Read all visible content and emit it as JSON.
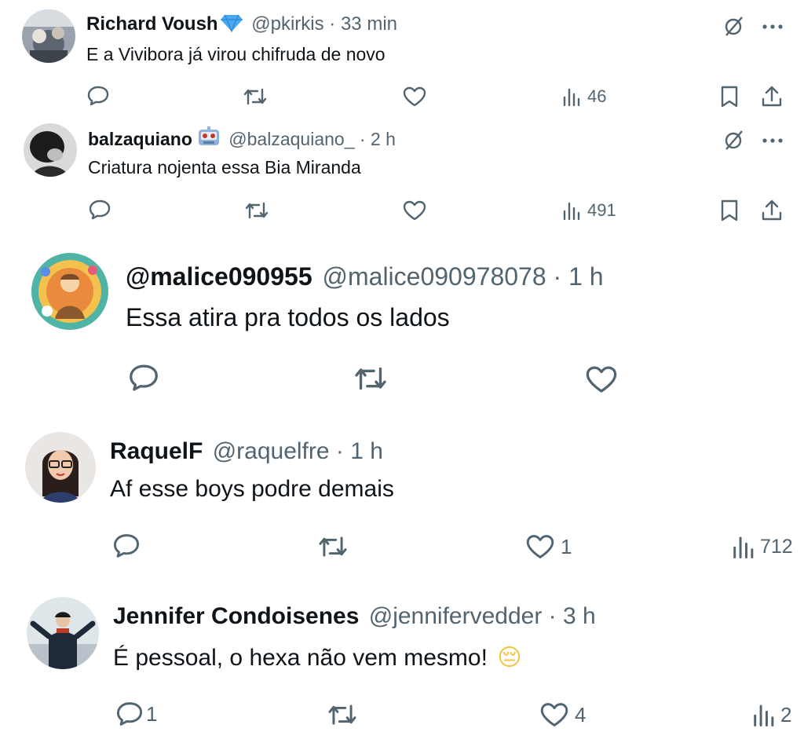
{
  "tweets": [
    {
      "name": "Richard Voush",
      "handle": "@pkirkis",
      "time": "· 33 min",
      "text": "E a Vivibora já virou chifruda de novo",
      "views": "46",
      "name_badge": "diamond-icon"
    },
    {
      "name": "balzaquiano",
      "handle": "@balzaquiano_",
      "time": "· 2 h",
      "text": "Criatura nojenta essa Bia Miranda",
      "views": "491",
      "name_badge": "robot-emoji-icon"
    },
    {
      "name": "@malice090955",
      "handle": "@malice090978078",
      "time": "· 1 h",
      "text": "Essa atira pra todos os lados"
    },
    {
      "name": "RaquelF",
      "handle": "@raquelfre",
      "time": "· 1 h",
      "text": "Af esse boys podre demais",
      "likes": "1",
      "views": "712"
    },
    {
      "name": "Jennifer Condoisenes",
      "handle": "@jennifervedder",
      "time": "· 3 h",
      "text": "É pessoal, o hexa não vem mesmo!",
      "emoji": "😔",
      "replies": "1",
      "likes": "4",
      "views": "2"
    }
  ],
  "colors": {
    "text": "#0f1419",
    "secondary": "#536471",
    "verified": "#1d9bf0"
  }
}
